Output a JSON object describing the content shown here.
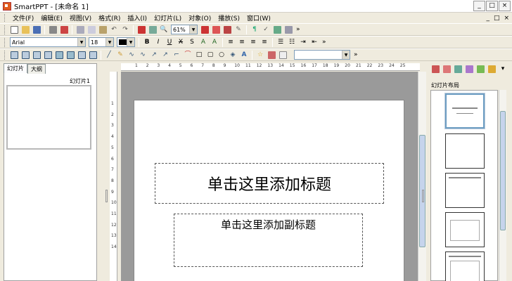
{
  "window": {
    "title": "SmartPPT - [未命名 1]",
    "controls": [
      "_",
      "□",
      "×"
    ]
  },
  "menu": {
    "items": [
      "文件(F)",
      "编辑(E)",
      "视图(V)",
      "格式(R)",
      "插入(I)",
      "幻灯片(L)",
      "对象(O)",
      "播放(S)",
      "窗口(W)"
    ],
    "mdi": [
      "_",
      "□",
      "×"
    ]
  },
  "toolbar1": {
    "zoom": "61%",
    "more": "»"
  },
  "toolbar2": {
    "font": "Arial",
    "size": "18",
    "more": "»"
  },
  "toolbar3": {
    "shape_combo": "",
    "more": "»"
  },
  "leftpanel": {
    "tabs": [
      "幻灯片",
      "大纲"
    ],
    "slide_label": "幻灯片1"
  },
  "ruler": {
    "h_ticks": [
      "1",
      "2",
      "3",
      "4",
      "5",
      "6",
      "7",
      "8",
      "9",
      "10",
      "11",
      "12",
      "13",
      "14",
      "15",
      "16",
      "17",
      "18",
      "19",
      "20",
      "21",
      "22",
      "23",
      "24",
      "25"
    ],
    "v_ticks": [
      "1",
      "2",
      "3",
      "4",
      "5",
      "6",
      "7",
      "8",
      "9",
      "10",
      "11",
      "12",
      "13",
      "14"
    ]
  },
  "slide": {
    "title_placeholder": "单击这里添加标题",
    "subtitle_placeholder": "单击这里添加副标题"
  },
  "rightpanel": {
    "title": "幻灯片布局"
  }
}
